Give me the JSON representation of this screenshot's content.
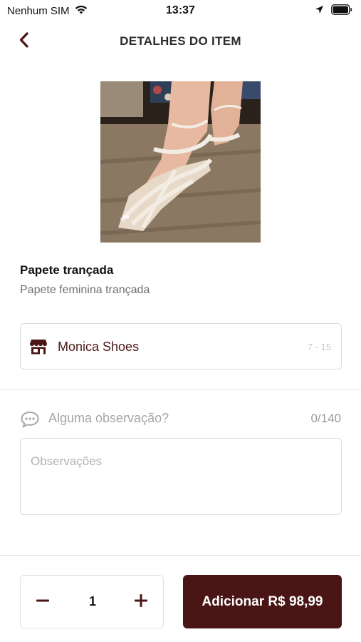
{
  "status_bar": {
    "carrier": "Nenhum SIM",
    "time": "13:37",
    "wifi_icon": "wifi-icon",
    "location_icon": "location-arrow-icon",
    "battery_icon": "battery-icon"
  },
  "header": {
    "title": "DETALHES DO ITEM",
    "back_icon": "chevron-left-icon"
  },
  "product": {
    "name": "Papete trançada",
    "description": "Papete feminina trançada"
  },
  "store": {
    "name": "Monica Shoes",
    "range": "7 - 15",
    "icon": "store-icon"
  },
  "observation": {
    "label": "Alguma observação?",
    "counter": "0/140",
    "placeholder": "Observações",
    "icon": "chat-bubble-icon"
  },
  "footer": {
    "quantity": "1",
    "add_button_label": "Adicionar R$ 98,99"
  },
  "colors": {
    "brand": "#4a1515",
    "store_text": "#4a1818",
    "border": "#dcdcdc"
  }
}
